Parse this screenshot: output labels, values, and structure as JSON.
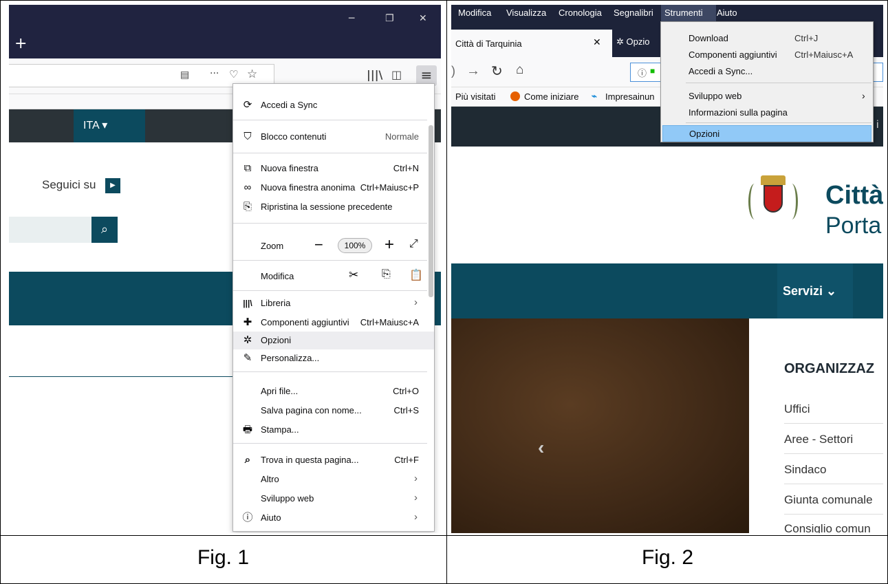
{
  "fig1": {
    "caption": "Fig. 1",
    "titlebar": {
      "new_tab": "+",
      "minimize": "─",
      "restore": "❐",
      "close": "✕"
    },
    "site": {
      "lang": "ITA",
      "follow": "Seguici su"
    },
    "menu": {
      "sync": "Accedi a Sync",
      "block": {
        "label": "Blocco contenuti",
        "value": "Normale"
      },
      "new_window": {
        "label": "Nuova finestra",
        "shortcut": "Ctrl+N"
      },
      "private_window": {
        "label": "Nuova finestra anonima",
        "shortcut": "Ctrl+Maiusc+P"
      },
      "restore_session": "Ripristina la sessione precedente",
      "zoom": {
        "label": "Zoom",
        "minus": "−",
        "value": "100%",
        "plus": "+"
      },
      "edit": {
        "label": "Modifica"
      },
      "library": "Libreria",
      "addons": {
        "label": "Componenti aggiuntivi",
        "shortcut": "Ctrl+Maiusc+A"
      },
      "options": "Opzioni",
      "customize": "Personalizza...",
      "open_file": {
        "label": "Apri file...",
        "shortcut": "Ctrl+O"
      },
      "save_page": {
        "label": "Salva pagina con nome...",
        "shortcut": "Ctrl+S"
      },
      "print": "Stampa...",
      "find": {
        "label": "Trova in questa pagina...",
        "shortcut": "Ctrl+F"
      },
      "more": "Altro",
      "webdev": "Sviluppo web",
      "help": "Aiuto"
    }
  },
  "fig2": {
    "caption": "Fig. 2",
    "menubar": [
      "Modifica",
      "Visualizza",
      "Cronologia",
      "Segnalibri",
      "Strumenti",
      "Aiuto"
    ],
    "tab_title": "Città di Tarquinia",
    "tab2_title": "Opzio",
    "bookmarks": [
      "Più visitati",
      "Come iniziare",
      "Impresainun"
    ],
    "tools_menu": {
      "download": {
        "label": "Download",
        "shortcut": "Ctrl+J"
      },
      "addons": {
        "label": "Componenti aggiuntivi",
        "shortcut": "Ctrl+Maiusc+A"
      },
      "sync": "Accedi a Sync...",
      "webdev": "Sviluppo web",
      "page_info": "Informazioni sulla pagina",
      "options": "Opzioni"
    },
    "site": {
      "title": "Città",
      "subtitle": "Porta",
      "nav_services": "Servizi",
      "section_title": "ORGANIZZAZ",
      "links": [
        "Uffici",
        "Aree - Settori",
        "Sindaco",
        "Giunta comunale",
        "Consiglio comun"
      ],
      "dark_bar_text": "i"
    }
  }
}
